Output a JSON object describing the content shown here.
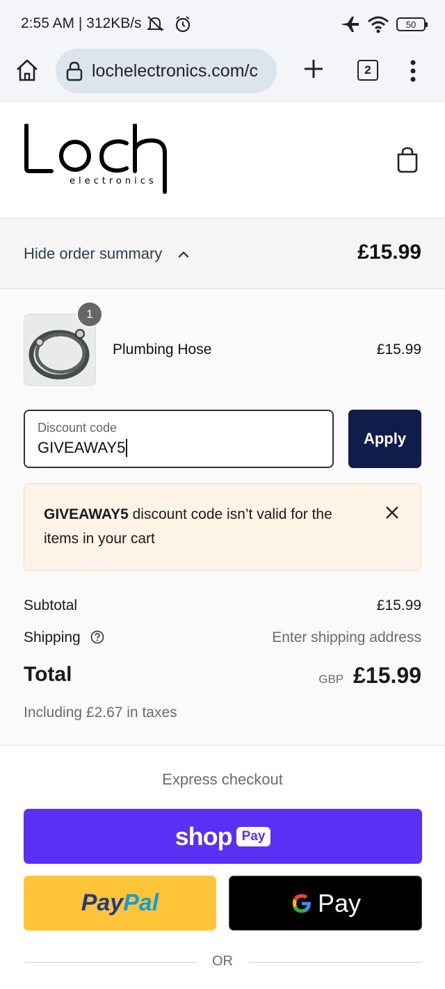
{
  "status_bar": {
    "time": "2:55 AM | 312KB/s",
    "battery": "50"
  },
  "browser": {
    "url": "lochelectronics.com/c",
    "tab_count": "2"
  },
  "shop": {
    "logo_main": "Loch",
    "logo_sub": "electronics"
  },
  "summary": {
    "toggle_label": "Hide order summary",
    "total": "£15.99"
  },
  "item": {
    "quantity": "1",
    "name": "Plumbing Hose",
    "price": "£15.99"
  },
  "discount": {
    "label": "Discount code",
    "value": "GIVEAWAY5",
    "apply_label": "Apply"
  },
  "error": {
    "code": "GIVEAWAY5",
    "message": " discount code isn’t valid for the items in your cart"
  },
  "totals": {
    "subtotal_label": "Subtotal",
    "subtotal_value": "£15.99",
    "shipping_label": "Shipping",
    "shipping_value": "Enter shipping address",
    "total_label": "Total",
    "currency": "GBP",
    "total_value": "£15.99",
    "taxes": "Including £2.67 in taxes"
  },
  "express": {
    "title": "Express checkout",
    "shop_word": "shop",
    "shop_badge": "Pay",
    "paypal_a": "Pay",
    "paypal_b": "Pal",
    "gpay_text": "Pay",
    "or_text": "OR"
  },
  "colors": {
    "apply_button": "#101d4b",
    "error_background": "#fdf3e7",
    "shop_pay": "#5a31f4",
    "paypal": "#ffc439",
    "gpay": "#000000"
  }
}
